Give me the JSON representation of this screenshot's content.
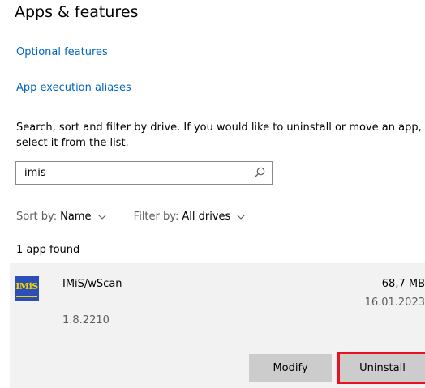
{
  "page": {
    "title": "Apps & features"
  },
  "links": {
    "optional_features": "Optional features",
    "app_execution_aliases": "App execution aliases"
  },
  "description": "Search, sort and filter by drive. If you would like to uninstall or move an app, select it from the list.",
  "search": {
    "value": "imis",
    "icon": "search-icon"
  },
  "sort": {
    "label": "Sort by:",
    "value": "Name"
  },
  "filter": {
    "label": "Filter by:",
    "value": "All drives"
  },
  "result_count": "1 app found",
  "apps": [
    {
      "name": "IMiS/wScan",
      "version": "1.8.2210",
      "size": "68,7 MB",
      "date": "16.01.2023",
      "logo_text": "IMiS",
      "actions": {
        "modify": "Modify",
        "uninstall": "Uninstall"
      }
    }
  ],
  "colors": {
    "link": "#0067c0",
    "card_background": "#f2f2f2",
    "button_background": "#cccccc",
    "highlight": "#e81123",
    "logo_background": "#2b4fb6",
    "logo_foreground": "#f2d300"
  }
}
